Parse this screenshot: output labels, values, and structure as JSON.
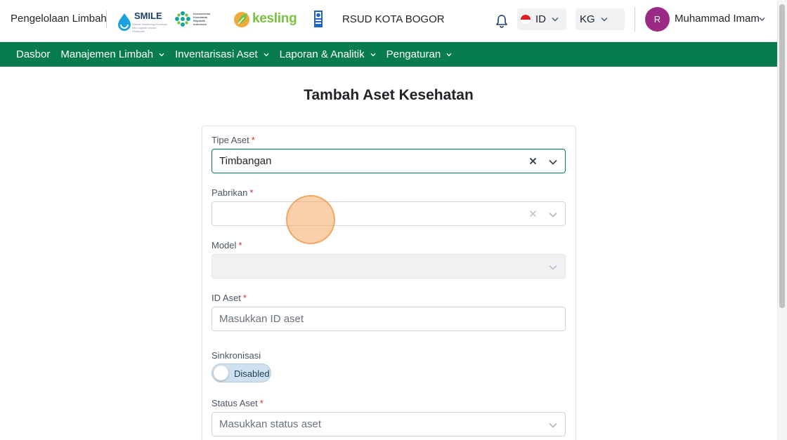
{
  "header": {
    "app_title": "Pengelolaan Limbah",
    "logos": [
      {
        "name": "SMILE",
        "sub": "Sistem Monitoring Imunisasi dan Logistik secara Elektronik"
      },
      {
        "name": "Kementerian Kesehatan Republik Indonesia"
      },
      {
        "name": "kesling"
      },
      {
        "name": "UNDP"
      }
    ],
    "hospital": "RSUD KOTA BOGOR",
    "language": "ID",
    "unit": "KG",
    "user": {
      "initial": "R",
      "name": "Muhammad Imam"
    }
  },
  "nav": {
    "items": [
      {
        "label": "Dasbor",
        "has_dropdown": false
      },
      {
        "label": "Manajemen Limbah",
        "has_dropdown": true
      },
      {
        "label": "Inventarisasi Aset",
        "has_dropdown": true
      },
      {
        "label": "Laporan & Analitik",
        "has_dropdown": true
      },
      {
        "label": "Pengaturan",
        "has_dropdown": true
      }
    ]
  },
  "page": {
    "title": "Tambah Aset Kesehatan"
  },
  "form": {
    "required_mark": "*",
    "asset_type": {
      "label": "Tipe Aset",
      "value": "Timbangan"
    },
    "manufacturer": {
      "label": "Pabrikan",
      "value": ""
    },
    "model": {
      "label": "Model",
      "value": ""
    },
    "asset_id": {
      "label": "ID Aset",
      "placeholder": "Masukkan ID aset"
    },
    "sync": {
      "label": "Sinkronisasi",
      "state": "Disabled"
    },
    "asset_status": {
      "label": "Status Aset",
      "placeholder": "Masukkan status aset"
    }
  },
  "colors": {
    "brand_green": "#087b4f",
    "avatar": "#9b2a86",
    "required": "#d0312d"
  }
}
